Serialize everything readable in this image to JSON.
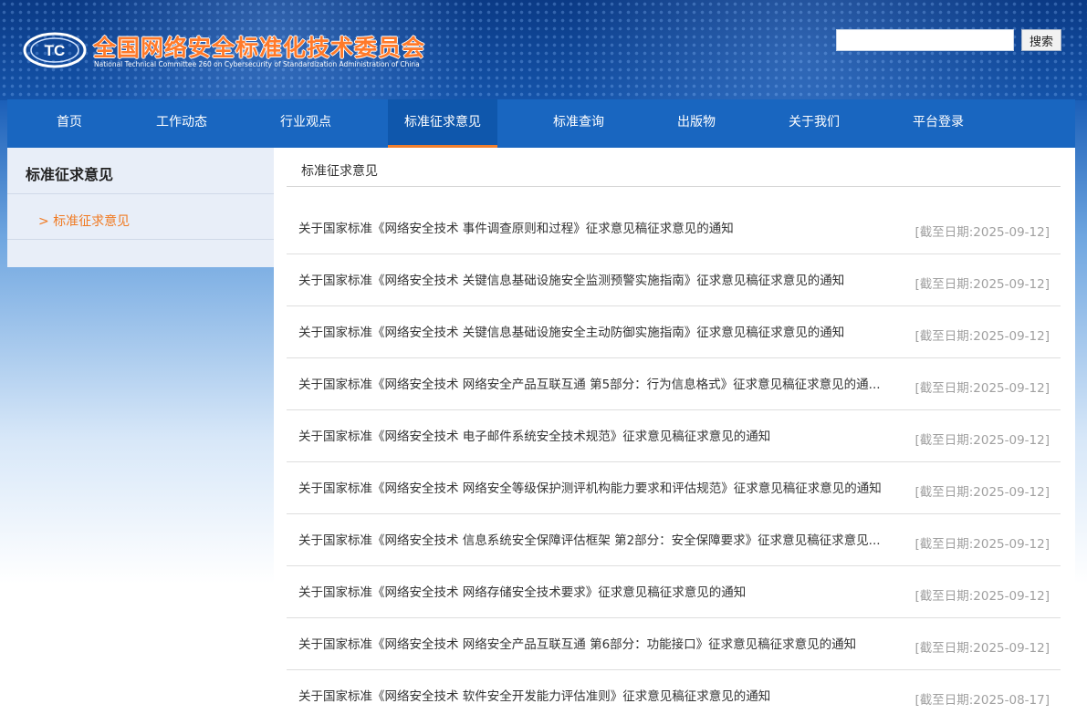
{
  "header": {
    "title": "全国网络安全标准化技术委员会",
    "subtitle": "National Technical Committee 260 on Cybersecurity of Standardization Administration of China",
    "logo_text": "TC",
    "search_value": "",
    "search_button": "搜索"
  },
  "nav": {
    "items": [
      {
        "label": "首页"
      },
      {
        "label": "工作动态"
      },
      {
        "label": "行业观点"
      },
      {
        "label": "标准征求意见"
      },
      {
        "label": "标准查询"
      },
      {
        "label": "出版物"
      },
      {
        "label": "关于我们"
      },
      {
        "label": "平台登录"
      }
    ],
    "active": "标准征求意见"
  },
  "sidebar": {
    "title": "标准征求意见",
    "items": [
      {
        "label": "> 标准征求意见"
      }
    ]
  },
  "main": {
    "title": "标准征求意见",
    "items": [
      {
        "title": "关于国家标准《网络安全技术 事件调查原则和过程》征求意见稿征求意见的通知",
        "date": "[截至日期:2025-09-12]"
      },
      {
        "title": "关于国家标准《网络安全技术 关键信息基础设施安全监测预警实施指南》征求意见稿征求意见的通知",
        "date": "[截至日期:2025-09-12]"
      },
      {
        "title": "关于国家标准《网络安全技术 关键信息基础设施安全主动防御实施指南》征求意见稿征求意见的通知",
        "date": "[截至日期:2025-09-12]"
      },
      {
        "title": "关于国家标准《网络安全技术 网络安全产品互联互通 第5部分：行为信息格式》征求意见稿征求意见的通...",
        "date": "[截至日期:2025-09-12]"
      },
      {
        "title": "关于国家标准《网络安全技术 电子邮件系统安全技术规范》征求意见稿征求意见的通知",
        "date": "[截至日期:2025-09-12]"
      },
      {
        "title": "关于国家标准《网络安全技术 网络安全等级保护测评机构能力要求和评估规范》征求意见稿征求意见的通知",
        "date": "[截至日期:2025-09-12]"
      },
      {
        "title": "关于国家标准《网络安全技术 信息系统安全保障评估框架 第2部分：安全保障要求》征求意见稿征求意见...",
        "date": "[截至日期:2025-09-12]"
      },
      {
        "title": "关于国家标准《网络安全技术 网络存储安全技术要求》征求意见稿征求意见的通知",
        "date": "[截至日期:2025-09-12]"
      },
      {
        "title": "关于国家标准《网络安全技术 网络安全产品互联互通 第6部分：功能接口》征求意见稿征求意见的通知",
        "date": "[截至日期:2025-09-12]"
      },
      {
        "title": "关于国家标准《网络安全技术 软件安全开发能力评估准则》征求意见稿征求意见的通知",
        "date": "[截至日期:2025-08-17]"
      }
    ]
  },
  "colors": {
    "nav_bg": "#1966c0",
    "accent": "#f07f2e",
    "title_orange": "#ff7a2a",
    "date_gray": "#a0a0a0"
  }
}
